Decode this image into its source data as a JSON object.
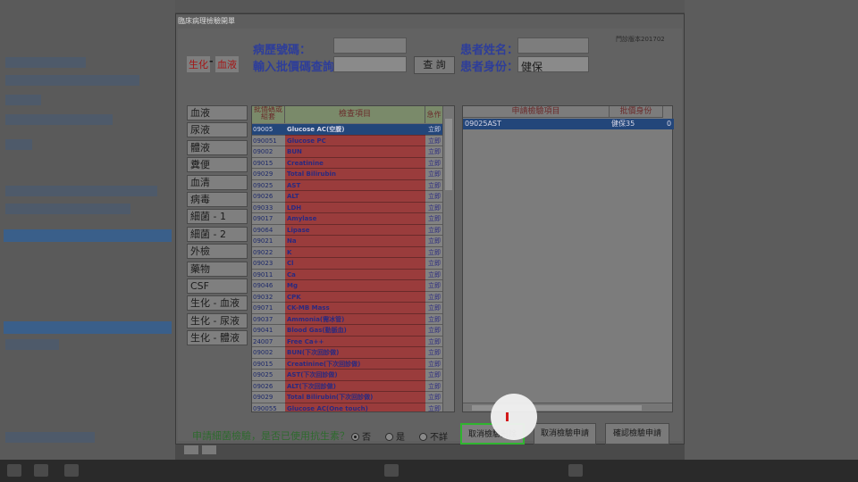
{
  "dialog": {
    "title": "臨床病理檢驗開單",
    "version": "門診版本201702"
  },
  "header": {
    "chart_no_label": "病歷號碼：",
    "batch_query_label": "輸入批價碼查詢：",
    "query_button": "查 詢",
    "patient_name_label": "患者姓名：",
    "patient_identity_label": "患者身份：",
    "patient_identity_value": "健保",
    "tag_biochem": "生化",
    "tag_sep": "-",
    "tag_blood": "血液"
  },
  "categories": [
    "血液",
    "尿液",
    "體液",
    "糞便",
    "血清",
    "病毒",
    "細菌 - 1",
    "細菌 - 2",
    "外檢",
    "藥物",
    "CSF",
    "生化 - 血液",
    "生化 - 尿液",
    "生化 - 體液"
  ],
  "grid": {
    "headers": [
      "批價碼或組套",
      "檢查項目",
      "急作"
    ],
    "rows": [
      {
        "code": "09005",
        "name": "Glucose AC(空腹)",
        "flag": "立即"
      },
      {
        "code": "090051",
        "name": "Glucose PC",
        "flag": "立即"
      },
      {
        "code": "09002",
        "name": "BUN",
        "flag": "立即"
      },
      {
        "code": "09015",
        "name": "Creatinine",
        "flag": "立即"
      },
      {
        "code": "09029",
        "name": "Total Bilirubin",
        "flag": "立即"
      },
      {
        "code": "09025",
        "name": "AST",
        "flag": "立即"
      },
      {
        "code": "09026",
        "name": "ALT",
        "flag": "立即"
      },
      {
        "code": "09033",
        "name": "LDH",
        "flag": "立即"
      },
      {
        "code": "09017",
        "name": "Amylase",
        "flag": "立即"
      },
      {
        "code": "09064",
        "name": "Lipase",
        "flag": "立即"
      },
      {
        "code": "09021",
        "name": "Na",
        "flag": "立即"
      },
      {
        "code": "09022",
        "name": "K",
        "flag": "立即"
      },
      {
        "code": "09023",
        "name": "Cl",
        "flag": "立即"
      },
      {
        "code": "09011",
        "name": "Ca",
        "flag": "立即"
      },
      {
        "code": "09046",
        "name": "Mg",
        "flag": "立即"
      },
      {
        "code": "09032",
        "name": "CPK",
        "flag": "立即"
      },
      {
        "code": "09071",
        "name": "CK-MB Mass",
        "flag": "立即"
      },
      {
        "code": "09037",
        "name": "Ammonia(需冰管)",
        "flag": "立即"
      },
      {
        "code": "09041",
        "name": "Blood Gas(動脈血)",
        "flag": "立即"
      },
      {
        "code": "24007",
        "name": "Free Ca++",
        "flag": "立即"
      },
      {
        "code": "09002",
        "name": "BUN(下次回診做)",
        "flag": "立即"
      },
      {
        "code": "09015",
        "name": "Creatinine(下次回診做)",
        "flag": "立即"
      },
      {
        "code": "09025",
        "name": "AST(下次回診做)",
        "flag": "立即"
      },
      {
        "code": "09026",
        "name": "ALT(下次回診做)",
        "flag": "立即"
      },
      {
        "code": "09029",
        "name": "Total Bilirubin(下次回診做)",
        "flag": "立即"
      },
      {
        "code": "090055",
        "name": "Glucose AC(One touch)",
        "flag": "立即"
      }
    ]
  },
  "request_list": {
    "headers": [
      "申請檢驗項目",
      "批價身份"
    ],
    "rows": [
      {
        "item": "09025AST",
        "identity": "健保35",
        "extra": "0"
      }
    ]
  },
  "antibiotic": {
    "question": "申請細菌檢驗，是否已使用抗生素？",
    "options": [
      "否",
      "是",
      "不詳"
    ],
    "selected": "否"
  },
  "actions": {
    "cancel_delete": "取消檢驗刪除",
    "cancel_request": "取消檢驗申請",
    "confirm_request": "確認檢驗申請"
  }
}
